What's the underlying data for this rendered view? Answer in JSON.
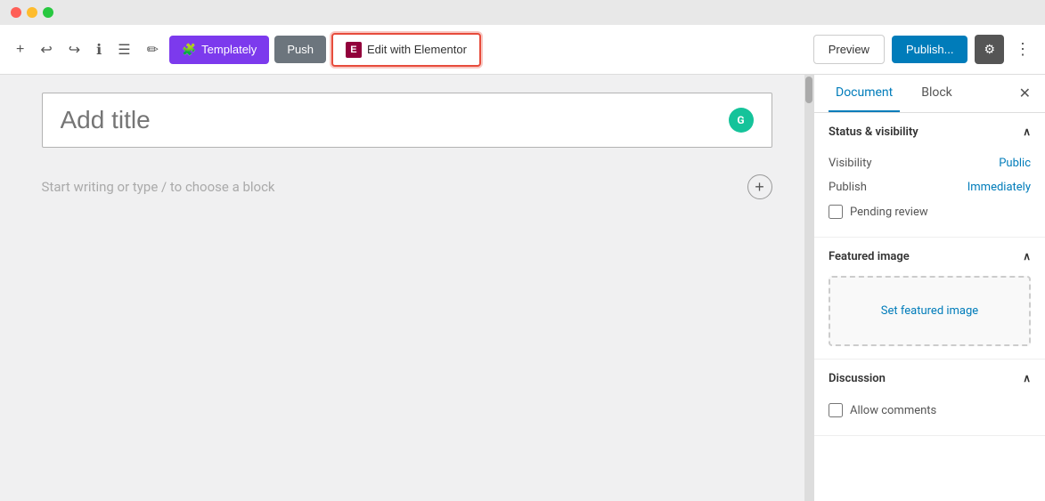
{
  "titlebar": {
    "close_label": "",
    "minimize_label": "",
    "maximize_label": ""
  },
  "toolbar": {
    "add_label": "+",
    "undo_label": "↩",
    "redo_label": "↪",
    "info_label": "ℹ",
    "list_label": "☰",
    "edit_label": "✏",
    "templately_label": "Templately",
    "push_label": "Push",
    "elementor_label": "Edit with Elementor",
    "preview_label": "Preview",
    "publish_label": "Publish...",
    "settings_label": "⚙",
    "more_label": "⋮"
  },
  "editor": {
    "title_placeholder": "Add title",
    "content_placeholder": "Start writing or type / to choose a block"
  },
  "sidebar": {
    "document_tab": "Document",
    "block_tab": "Block",
    "sections": {
      "status_visibility": {
        "label": "Status & visibility",
        "visibility_label": "Visibility",
        "visibility_value": "Public",
        "publish_label": "Publish",
        "publish_value": "Immediately",
        "pending_review_label": "Pending review"
      },
      "featured_image": {
        "label": "Featured image",
        "set_image_label": "Set featured image"
      },
      "discussion": {
        "label": "Discussion",
        "allow_comments_label": "Allow comments"
      }
    }
  }
}
